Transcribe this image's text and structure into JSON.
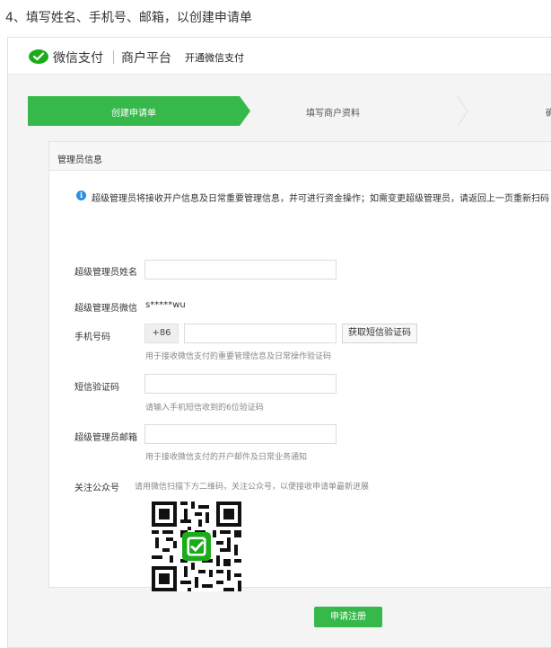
{
  "caption": "4、填写姓名、手机号、邮箱，以创建申请单",
  "header": {
    "brand": "微信支付",
    "platform": "商户平台",
    "subtitle": "开通微信支付"
  },
  "steps": [
    {
      "label": "创建申请单",
      "active": true
    },
    {
      "label": "填写商户资料",
      "active": false
    },
    {
      "label": "确",
      "active": false
    }
  ],
  "panel": {
    "title": "管理员信息",
    "notice": "超级管理员将接收开户信息及日常重要管理信息，并可进行资金操作；如需变更超级管理员，请返回上一页重新扫码"
  },
  "form": {
    "name_label": "超级管理员姓名",
    "wechat_label": "超级管理员微信",
    "wechat_value": "s*****wu",
    "phone_label": "手机号码",
    "phone_prefix": "+86",
    "sms_button": "获取短信验证码",
    "phone_hint": "用于接收微信支付的重要管理信息及日常操作验证码",
    "code_label": "短信验证码",
    "code_hint": "请输入手机短信收到的6位验证码",
    "email_label": "超级管理员邮箱",
    "email_hint": "用于接收微信支付的开户邮件及日常业务通知",
    "follow_label": "关注公众号",
    "follow_hint": "请用微信扫描下方二维码，关注公众号，以便接收申请单最新进展"
  },
  "submit_label": "申请注册",
  "colors": {
    "accent_green": "#36b94a",
    "info_blue": "#2f8ee0"
  },
  "icons": [
    "wechat-pay-logo",
    "info-icon",
    "qr-code"
  ]
}
